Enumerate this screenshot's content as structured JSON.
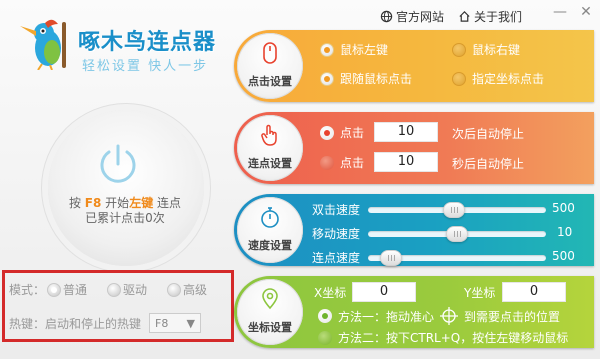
{
  "app": {
    "title": "啄木鸟连点器",
    "subtitle": "轻松设置  快人一步"
  },
  "header": {
    "official_site": "官方网站",
    "about": "关于我们"
  },
  "power": {
    "line1_prefix": "按",
    "hotkey": "F8",
    "line1_mid": "开始",
    "button": "左键",
    "line1_suffix": "连点",
    "line2": "已累计点击0次"
  },
  "mode": {
    "label": "模式：",
    "options": [
      "普通",
      "驱动",
      "高级"
    ],
    "selected": "普通",
    "hotkey_label": "热键：启动和停止的热键",
    "hotkey_value": "F8"
  },
  "click_settings": {
    "label": "点击设置",
    "options": [
      "鼠标左键",
      "鼠标右键",
      "跟随鼠标点击",
      "指定坐标点击"
    ],
    "selected": [
      "鼠标左键",
      "跟随鼠标点击"
    ]
  },
  "repeat_settings": {
    "label": "连点设置",
    "row1": {
      "prefix": "点击",
      "value": "10",
      "suffix": "次后自动停止"
    },
    "row2": {
      "prefix": "点击",
      "value": "10",
      "suffix": "秒后自动停止"
    },
    "selected_row": 1
  },
  "speed_settings": {
    "label": "速度设置",
    "sliders": [
      {
        "name": "双击速度",
        "value": "500",
        "level": 0.48
      },
      {
        "name": "移动速度",
        "value": "10",
        "level": 0.5
      },
      {
        "name": "连点速度",
        "value": "500",
        "level": 0.08
      }
    ]
  },
  "coord_settings": {
    "label": "坐标设置",
    "x_label": "X坐标",
    "x_value": "0",
    "y_label": "Y坐标",
    "y_value": "0",
    "method1": "方法一：拖动准心",
    "method1_suffix": "到需要点击的位置",
    "method2": "方法二：按下CTRL+Q，按住左键移动鼠标",
    "selected": "method1"
  },
  "colors": {
    "accent_blue": "#1a8fc9",
    "accent_orange": "#f08a1b",
    "panel_click": "#f8a93a",
    "panel_repeat": "#ee5f4d",
    "panel_speed": "#1d8fc3",
    "panel_coord": "#8dc63f",
    "highlight_border": "#d42a2a"
  }
}
